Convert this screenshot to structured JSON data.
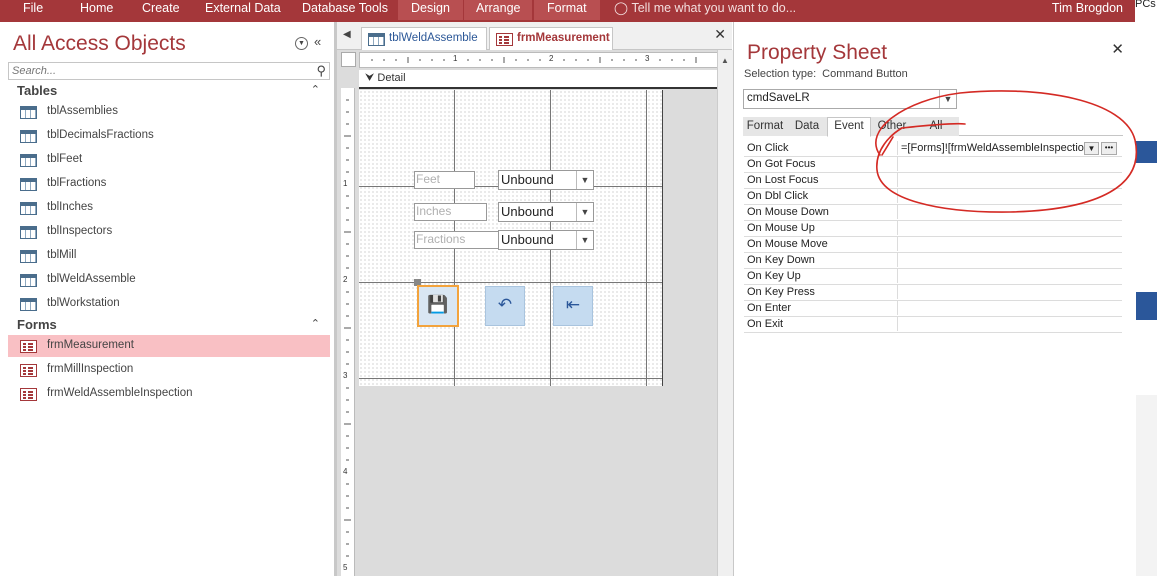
{
  "ribbon": {
    "tabs": [
      {
        "label": "File"
      },
      {
        "label": "Home"
      },
      {
        "label": "Create"
      },
      {
        "label": "External Data"
      },
      {
        "label": "Database Tools"
      },
      {
        "label": "Design"
      },
      {
        "label": "Arrange"
      },
      {
        "label": "Format"
      }
    ],
    "tell_me": "Tell me what you want to do...",
    "user": "Tim Brogdon",
    "accent_color": "#a4373a"
  },
  "edge_text": "PCs",
  "nav": {
    "title": "All Access Objects",
    "search_placeholder": "Search...",
    "groups": [
      {
        "label": "Tables",
        "items": [
          "tblAssemblies",
          "tblDecimalsFractions",
          "tblFeet",
          "tblFractions",
          "tblInches",
          "tblInspectors",
          "tblMill",
          "tblWeldAssemble",
          "tblWorkstation"
        ]
      },
      {
        "label": "Forms",
        "items": [
          "frmMeasurement",
          "frmMillInspection",
          "frmWeldAssembleInspection"
        ]
      }
    ],
    "selected_item": "frmMeasurement"
  },
  "documents": {
    "tabs": [
      {
        "label": "tblWeldAssemble",
        "icon": "table-icon"
      },
      {
        "label": "frmMeasurement",
        "icon": "form-icon"
      }
    ],
    "active_tab": "frmMeasurement"
  },
  "form_design": {
    "section": "Detail",
    "ruler_top": [
      "1",
      "2",
      "3"
    ],
    "ruler_left": [
      "1",
      "2",
      "3",
      "4",
      "5"
    ],
    "fields": [
      {
        "label": "Feet",
        "value": "Unbound"
      },
      {
        "label": "Inches",
        "value": "Unbound"
      },
      {
        "label": "Fractions",
        "value": "Unbound"
      }
    ],
    "buttons": [
      {
        "icon": "save-icon"
      },
      {
        "icon": "undo-icon"
      },
      {
        "icon": "exit-icon"
      }
    ]
  },
  "property_sheet": {
    "title": "Property Sheet",
    "selection_type_label": "Selection type:",
    "selection_type": "Command Button",
    "object": "cmdSaveLR",
    "tabs": [
      "Format",
      "Data",
      "Event",
      "Other",
      "All"
    ],
    "active_tab": "Event",
    "properties": [
      {
        "name": "On Click",
        "value": "=[Forms]![frmWeldAssembleInspectio"
      },
      {
        "name": "On Got Focus",
        "value": ""
      },
      {
        "name": "On Lost Focus",
        "value": ""
      },
      {
        "name": "On Dbl Click",
        "value": ""
      },
      {
        "name": "On Mouse Down",
        "value": ""
      },
      {
        "name": "On Mouse Up",
        "value": ""
      },
      {
        "name": "On Mouse Move",
        "value": ""
      },
      {
        "name": "On Key Down",
        "value": ""
      },
      {
        "name": "On Key Up",
        "value": ""
      },
      {
        "name": "On Key Press",
        "value": ""
      },
      {
        "name": "On Enter",
        "value": ""
      },
      {
        "name": "On Exit",
        "value": ""
      }
    ]
  }
}
